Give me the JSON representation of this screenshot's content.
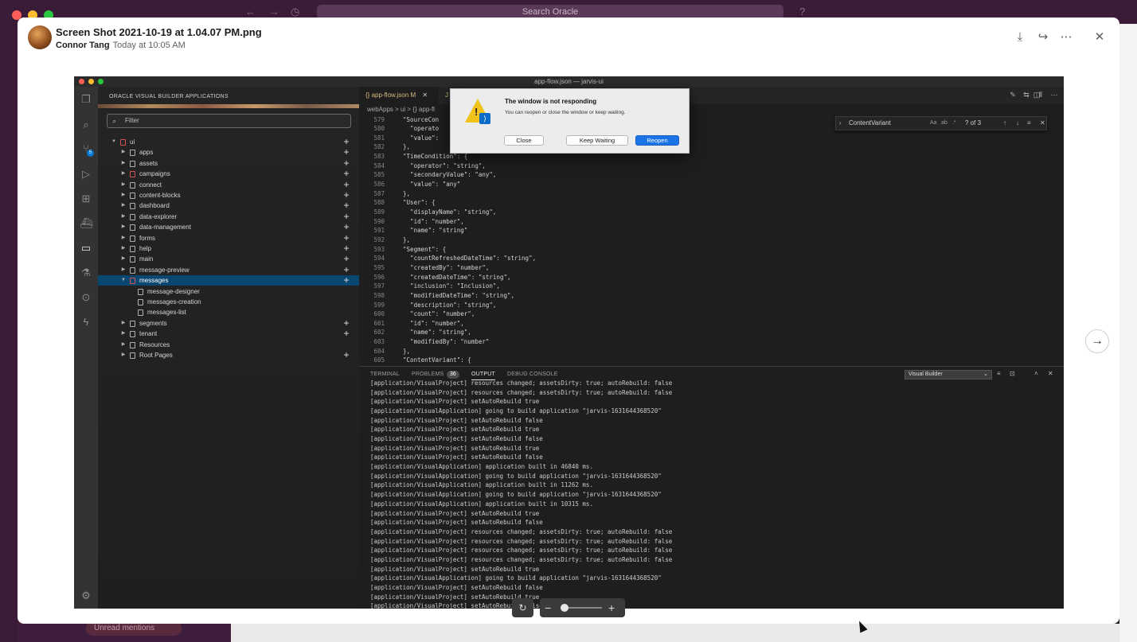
{
  "background": {
    "search_placeholder": "Search Oracle",
    "unread_label": "Unread mentions",
    "traffic_colors": [
      "#ff5f57",
      "#febc2e",
      "#28c840"
    ]
  },
  "modal": {
    "title": "Screen Shot 2021-10-19 at 1.04.07 PM.png",
    "author": "Connor Tang",
    "timestamp": "Today at 10:05 AM",
    "header_icons": [
      "download-icon",
      "share-icon",
      "more-icon",
      "close-icon"
    ]
  },
  "vscode": {
    "window_title": "app-flow.json — jarvis-ui",
    "sidebar_title": "ORACLE VISUAL BUILDER APPLICATIONS",
    "filter_placeholder": "Filter",
    "scm_badge": "5",
    "tree": [
      {
        "label": "ui",
        "level": 0,
        "expanded": true,
        "icon": "red-folder",
        "plus": true
      },
      {
        "label": "apps",
        "level": 1,
        "plus": true
      },
      {
        "label": "assets",
        "level": 1,
        "plus": true
      },
      {
        "label": "campaigns",
        "level": 1,
        "icon": "red",
        "plus": true
      },
      {
        "label": "connect",
        "level": 1,
        "plus": true
      },
      {
        "label": "content-blocks",
        "level": 1,
        "plus": true
      },
      {
        "label": "dashboard",
        "level": 1,
        "plus": true
      },
      {
        "label": "data-explorer",
        "level": 1,
        "plus": true
      },
      {
        "label": "data-management",
        "level": 1,
        "plus": true
      },
      {
        "label": "forms",
        "level": 1,
        "plus": true
      },
      {
        "label": "help",
        "level": 1,
        "plus": true
      },
      {
        "label": "main",
        "level": 1,
        "plus": true
      },
      {
        "label": "message-preview",
        "level": 1,
        "plus": true
      },
      {
        "label": "messages",
        "level": 1,
        "expanded": true,
        "selected": true,
        "icon": "red",
        "plus": true
      },
      {
        "label": "message-designer",
        "level": 2,
        "leaf": true
      },
      {
        "label": "messages-creation",
        "level": 2,
        "leaf": true
      },
      {
        "label": "messages-list",
        "level": 2,
        "leaf": true
      },
      {
        "label": "segments",
        "level": 1,
        "plus": true
      },
      {
        "label": "tenant",
        "level": 1,
        "plus": true
      },
      {
        "label": "Resources",
        "level": 1,
        "plus": false
      },
      {
        "label": "Root Pages",
        "level": 1,
        "plus": true
      }
    ],
    "tab_active": "{} app-flow.json M",
    "tab_other": "J",
    "breadcrumb": "webApps > ui > {} app-fl",
    "find": {
      "query": "ContentVariant",
      "count": "? of 3"
    },
    "code": [
      {
        "n": "579",
        "t": "  \"SourceCon"
      },
      {
        "n": "580",
        "t": "    \"operato"
      },
      {
        "n": "581",
        "t": "    \"value\":"
      },
      {
        "n": "582",
        "t": "  },"
      },
      {
        "n": "583",
        "t": "  \"TimeCondition\": {"
      },
      {
        "n": "584",
        "t": "    \"operator\": \"string\","
      },
      {
        "n": "585",
        "t": "    \"secondaryValue\": \"any\","
      },
      {
        "n": "586",
        "t": "    \"value\": \"any\""
      },
      {
        "n": "587",
        "t": "  },"
      },
      {
        "n": "588",
        "t": "  \"User\": {"
      },
      {
        "n": "589",
        "t": "    \"displayName\": \"string\","
      },
      {
        "n": "590",
        "t": "    \"id\": \"number\","
      },
      {
        "n": "591",
        "t": "    \"name\": \"string\""
      },
      {
        "n": "592",
        "t": "  },"
      },
      {
        "n": "593",
        "t": "  \"Segment\": {"
      },
      {
        "n": "594",
        "t": "    \"countRefreshedDateTime\": \"string\","
      },
      {
        "n": "595",
        "t": "    \"createdBy\": \"number\","
      },
      {
        "n": "596",
        "t": "    \"createdDateTime\": \"string\","
      },
      {
        "n": "597",
        "t": "    \"inclusion\": \"Inclusion\","
      },
      {
        "n": "598",
        "t": "    \"modifiedDateTime\": \"string\","
      },
      {
        "n": "599",
        "t": "    \"description\": \"string\","
      },
      {
        "n": "600",
        "t": "    \"count\": \"number\","
      },
      {
        "n": "601",
        "t": "    \"id\": \"number\","
      },
      {
        "n": "602",
        "t": "    \"name\": \"string\","
      },
      {
        "n": "603",
        "t": "    \"modifiedBy\": \"number\""
      },
      {
        "n": "604",
        "t": "  },"
      },
      {
        "n": "605",
        "t": "  \"ContentVariant\": {"
      }
    ],
    "panel": {
      "tabs": [
        "TERMINAL",
        "PROBLEMS",
        "OUTPUT",
        "DEBUG CONSOLE"
      ],
      "problems_count": "36",
      "active_tab": "OUTPUT",
      "channel": "Visual Builder",
      "lines": [
        "[application/VisualProject] resources changed; assetsDirty: true; autoRebuild: false",
        "[application/VisualProject] resources changed; assetsDirty: true; autoRebuild: false",
        "[application/VisualProject] setAutoRebuild true",
        "[application/VisualApplication] going to build application \"jarvis-1631644368520\"",
        "[application/VisualProject] setAutoRebuild false",
        "[application/VisualProject] setAutoRebuild true",
        "[application/VisualProject] setAutoRebuild false",
        "[application/VisualProject] setAutoRebuild true",
        "[application/VisualProject] setAutoRebuild false",
        "[application/VisualApplication] application built in 46840 ms.",
        "[application/VisualApplication] going to build application \"jarvis-1631644368520\"",
        "[application/VisualApplication] application built in 11262 ms.",
        "[application/VisualApplication] going to build application \"jarvis-1631644368520\"",
        "[application/VisualApplication] application built in 10315 ms.",
        "[application/VisualProject] setAutoRebuild true",
        "[application/VisualProject] setAutoRebuild false",
        "[application/VisualProject] resources changed; assetsDirty: true; autoRebuild: false",
        "[application/VisualProject] resources changed; assetsDirty: true; autoRebuild: false",
        "[application/VisualProject] resources changed; assetsDirty: true; autoRebuild: false",
        "[application/VisualProject] resources changed; assetsDirty: true; autoRebuild: false",
        "[application/VisualProject] setAutoRebuild true",
        "[application/VisualApplication] going to build application \"jarvis-1631644368520\"",
        "[application/VisualProject] setAutoRebuild false",
        "[application/VisualProject] setAutoRebuild true",
        "[application/VisualProject] setAutoRebuild false"
      ]
    },
    "dialog": {
      "title": "The window is not responding",
      "message": "You can reopen or close the window or keep waiting.",
      "close": "Close",
      "keep_waiting": "Keep Waiting",
      "reopen": "Reopen"
    }
  }
}
